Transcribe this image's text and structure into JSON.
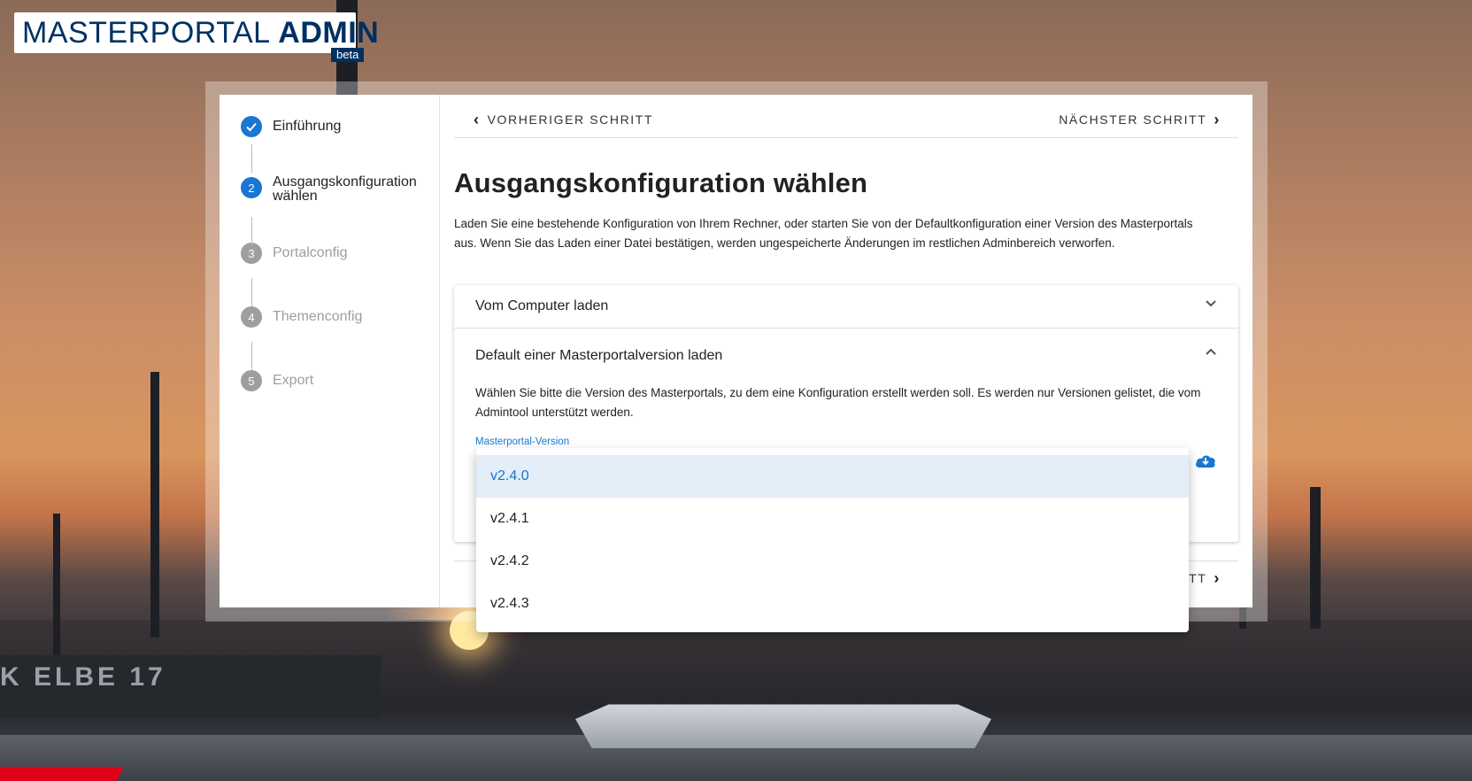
{
  "logo": {
    "text_light": "MASTERPORTAL",
    "text_bold": "ADMIN",
    "badge": "beta"
  },
  "background": {
    "ship_text": "K ELBE 17"
  },
  "stepper": {
    "steps": [
      {
        "number": "",
        "label": "Einführung",
        "state": "done",
        "icon": "check-icon"
      },
      {
        "number": "2",
        "label_line1": "Ausgangskonfiguration",
        "label_line2": "wählen",
        "state": "active"
      },
      {
        "number": "3",
        "label": "Portalconfig",
        "state": "idle"
      },
      {
        "number": "4",
        "label": "Themenconfig",
        "state": "idle"
      },
      {
        "number": "5",
        "label": "Export",
        "state": "idle"
      }
    ]
  },
  "nav": {
    "prev_label": "VORHERIGER SCHRITT",
    "next_label": "NÄCHSTER SCHRITT",
    "bottom_next_partial": "TT"
  },
  "main": {
    "title": "Ausgangskonfiguration wählen",
    "intro": "Laden Sie eine bestehende Konfiguration von Ihrem Rechner, oder starten Sie von der Defaultkonfiguration einer Version des Masterportals aus. Wenn Sie das Laden einer Datei bestätigen, werden ungespeicherte Änderungen im restlichen Adminbereich verworfen."
  },
  "panels": {
    "computer": {
      "title": "Vom Computer laden",
      "expanded": false
    },
    "default": {
      "title": "Default einer Masterportalversion laden",
      "expanded": true,
      "description": "Wählen Sie bitte die Version des Masterportals, zu dem eine Konfiguration erstellt werden soll. Es werden nur Versionen gelistet, die vom Admintool unterstützt werden.",
      "select_label": "Masterportal-Version",
      "load_icon": "cloud-download-icon"
    }
  },
  "dropdown": {
    "options": [
      "v2.4.0",
      "v2.4.1",
      "v2.4.2",
      "v2.4.3"
    ],
    "selected": "v2.4.0"
  },
  "colors": {
    "brand_blue": "#003063",
    "accent": "#1976d2",
    "idle_gray": "#9e9e9e"
  }
}
